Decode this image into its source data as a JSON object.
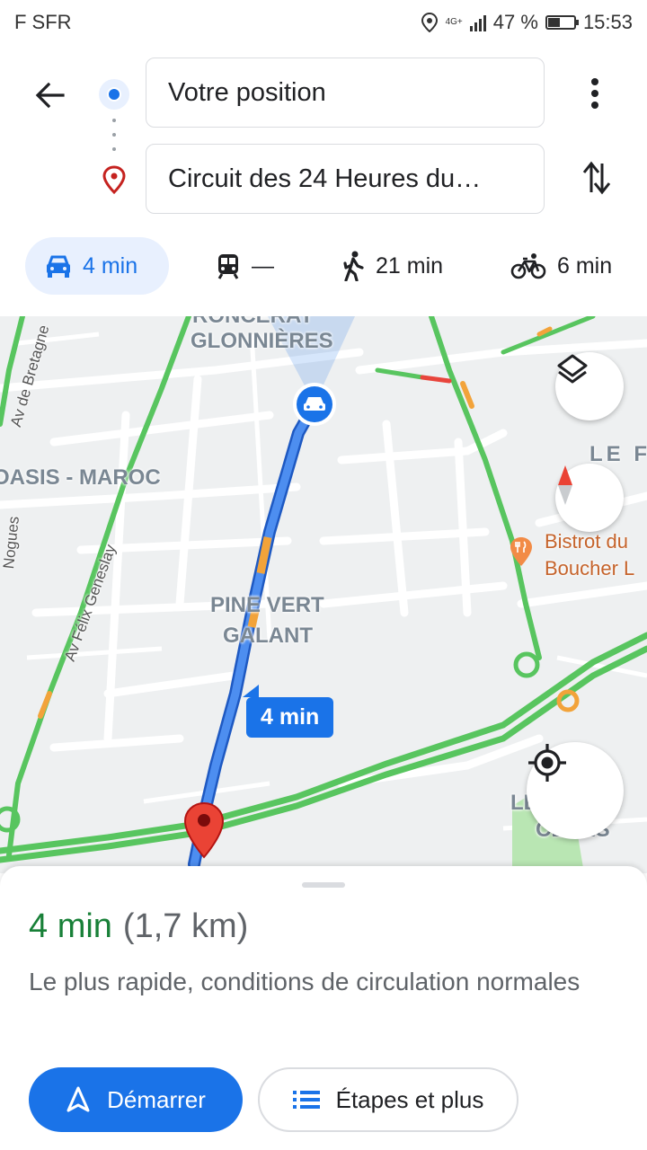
{
  "status_bar": {
    "carrier": "F SFR",
    "network": "4G+",
    "battery": "47 %",
    "battery_level": 0.47,
    "time": "15:53"
  },
  "directions": {
    "origin": "Votre position",
    "destination": "Circuit des 24 Heures du…",
    "icons": {
      "back": "arrow-left-icon",
      "more": "more-vert-icon",
      "swap": "swap-vert-icon",
      "destination": "map-pin-icon"
    }
  },
  "modes": [
    {
      "id": "car",
      "label": "4 min",
      "icon": "car-icon",
      "active": true
    },
    {
      "id": "transit",
      "label": "—",
      "icon": "train-icon",
      "active": false
    },
    {
      "id": "walk",
      "label": "21 min",
      "icon": "walk-icon",
      "active": false
    },
    {
      "id": "bike",
      "label": "6 min",
      "icon": "bike-icon",
      "active": false
    }
  ],
  "map": {
    "labels": {
      "ronceray": "RONCERAY",
      "glonnieres": "GLONNIÈRES",
      "oasis": "OASIS - MAROC",
      "le_fo": "LE FO",
      "pine1": "PINE VERT",
      "pine2": "GALANT",
      "ceres": "LES",
      "ceres2": "CÈRES"
    },
    "streets": {
      "bretagne": "Av de Bretagne",
      "genesley": "Av Félix Geneslay",
      "nogues": "Nogues"
    },
    "poi": {
      "line1": "Bistrot du",
      "line2": "Boucher L"
    },
    "route_time": "4 min",
    "colors": {
      "route": "#1a73e8",
      "traffic_green": "#58c55f",
      "traffic_orange": "#f2a33a",
      "traffic_red": "#e8453c"
    }
  },
  "route_summary": {
    "duration": "4 min",
    "distance": "(1,7 km)",
    "description": "Le plus rapide, conditions de circulation normales"
  },
  "actions": {
    "start_label": "Démarrer",
    "steps_label": "Étapes et plus"
  }
}
